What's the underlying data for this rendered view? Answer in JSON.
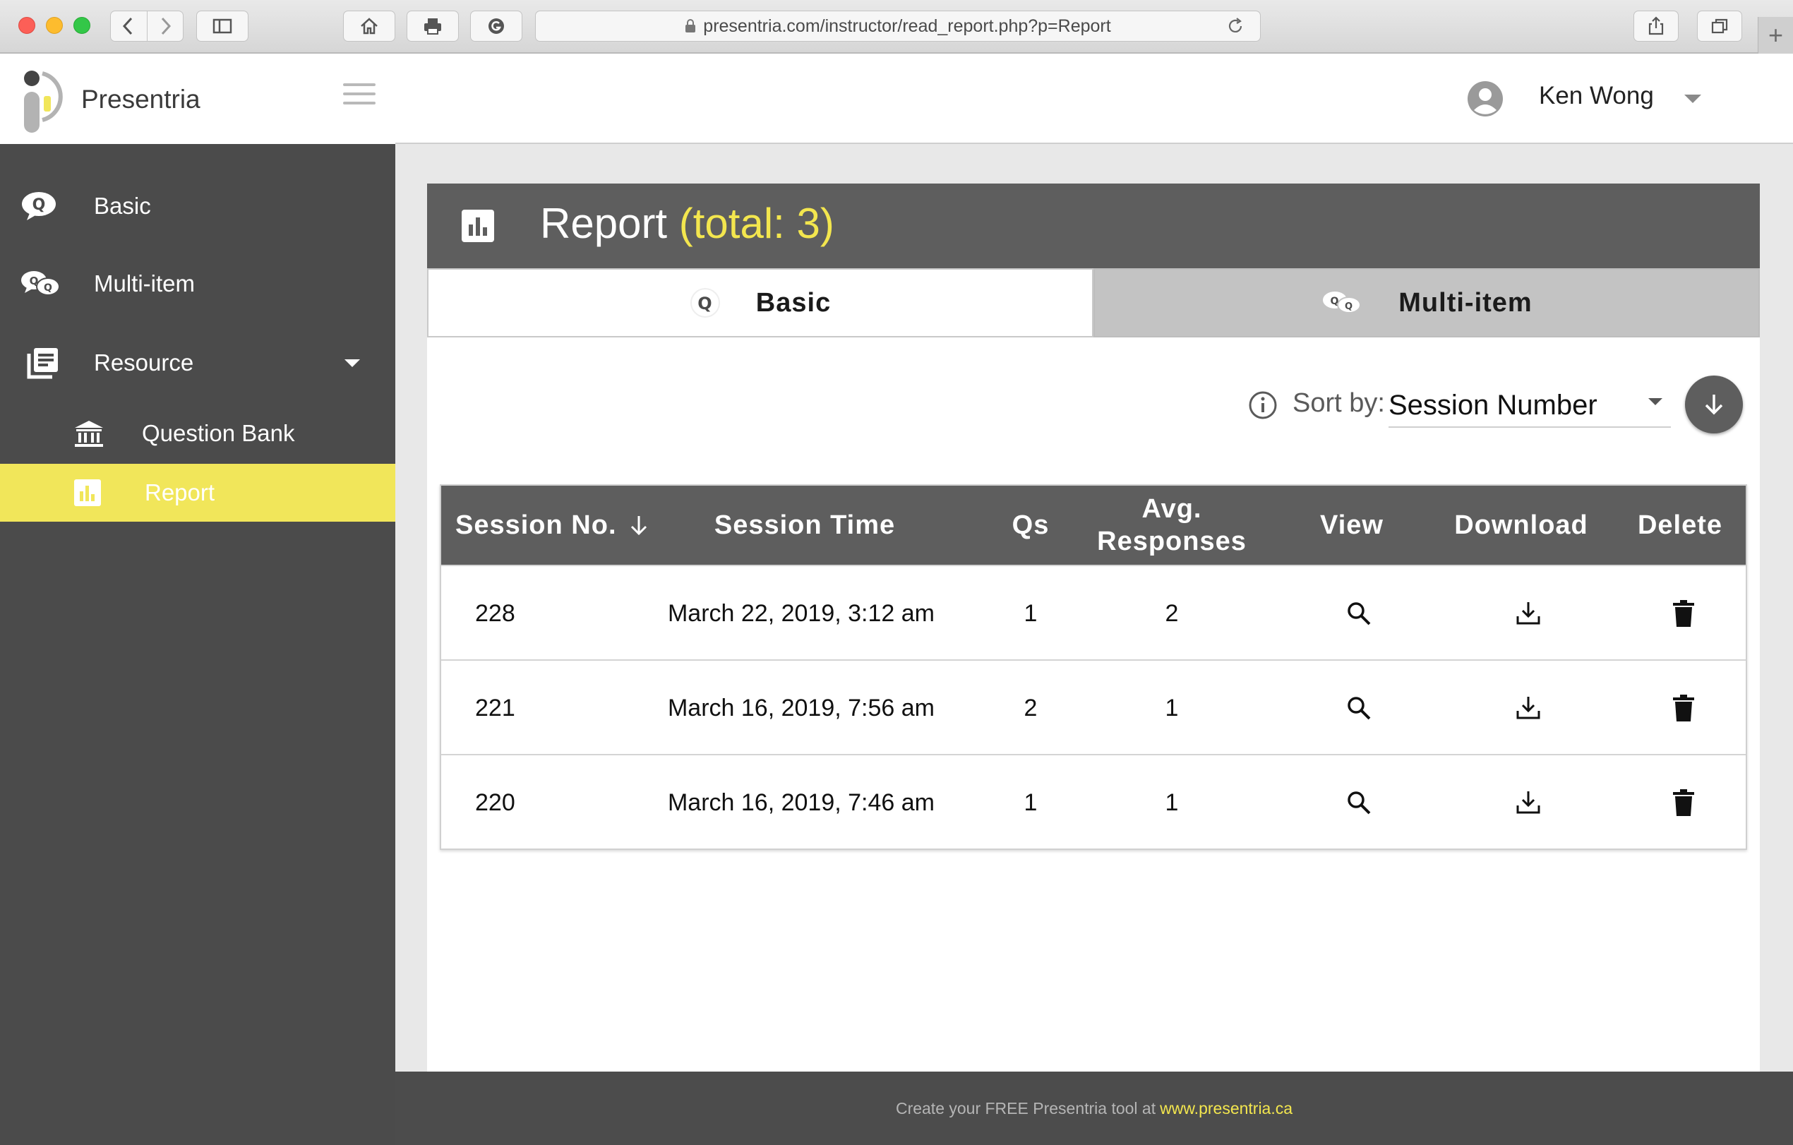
{
  "browser": {
    "url": "presentria.com/instructor/read_report.php?p=Report",
    "new_tab_symbol": "+"
  },
  "brand": {
    "name": "Presentria",
    "accent_color": "#f1e65a"
  },
  "user": {
    "name": "Ken Wong"
  },
  "sidebar": {
    "items": [
      {
        "label": "Basic",
        "icon": "basic-q-bubble-icon"
      },
      {
        "label": "Multi-item",
        "icon": "multi-q-bubble-icon"
      },
      {
        "label": "Resource",
        "icon": "resource-list-icon"
      },
      {
        "label": "Question Bank",
        "icon": "bank-icon"
      },
      {
        "label": "Report",
        "icon": "bar-chart-icon",
        "active": true
      }
    ]
  },
  "panel": {
    "title": "Report",
    "total": "(total: 3)",
    "tabs": [
      {
        "label": "Basic",
        "active": true
      },
      {
        "label": "Multi-item",
        "active": false
      }
    ],
    "sort": {
      "label": "Sort by:",
      "value": "Session Number"
    }
  },
  "table": {
    "headers": {
      "session": "Session No.",
      "time": "Session Time",
      "qs": "Qs",
      "avg_line1": "Avg.",
      "avg_line2": "Responses",
      "view": "View",
      "download": "Download",
      "delete": "Delete"
    },
    "rows": [
      {
        "session": "228",
        "time": "March 22, 2019, 3:12 am",
        "qs": "1",
        "avg": "2"
      },
      {
        "session": "221",
        "time": "March 16, 2019, 7:56 am",
        "qs": "2",
        "avg": "1"
      },
      {
        "session": "220",
        "time": "March 16, 2019, 7:46 am",
        "qs": "1",
        "avg": "1"
      }
    ]
  },
  "footer": {
    "text": "Create your FREE Presentria tool at",
    "link": "www.presentria.ca"
  }
}
